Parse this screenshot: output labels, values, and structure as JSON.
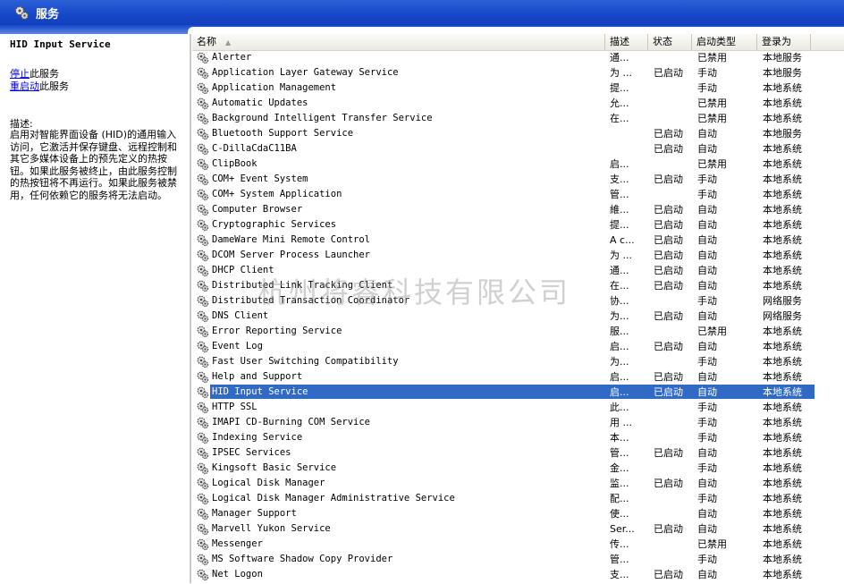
{
  "window": {
    "title": "服务"
  },
  "left_pane": {
    "service_title": "HID Input Service",
    "stop_link": "停止",
    "stop_suffix": "此服务",
    "restart_link": "重启动",
    "restart_suffix": "此服务",
    "desc_heading": "描述:",
    "desc_text": "启用对智能界面设备 (HID)的通用输入访问，它激活并保存键盘、远程控制和其它多媒体设备上的预先定义的热按钮。如果此服务被终止，由此服务控制的热按钮将不再运行。如果此服务被禁用，任何依赖它的服务将无法启动。"
  },
  "list": {
    "headers": {
      "name": "名称",
      "desc": "描述",
      "status": "状态",
      "startup": "启动类型",
      "logon": "登录为"
    },
    "selected_index": 22,
    "rows": [
      {
        "name": "Alerter",
        "desc": "通...",
        "status": "",
        "startup": "已禁用",
        "logon": "本地服务"
      },
      {
        "name": "Application Layer Gateway Service",
        "desc": "为 ...",
        "status": "已启动",
        "startup": "手动",
        "logon": "本地服务"
      },
      {
        "name": "Application Management",
        "desc": "提...",
        "status": "",
        "startup": "手动",
        "logon": "本地系统"
      },
      {
        "name": "Automatic Updates",
        "desc": "允...",
        "status": "",
        "startup": "已禁用",
        "logon": "本地系统"
      },
      {
        "name": "Background Intelligent Transfer Service",
        "desc": "在...",
        "status": "",
        "startup": "已禁用",
        "logon": "本地系统"
      },
      {
        "name": "Bluetooth Support Service",
        "desc": "",
        "status": "已启动",
        "startup": "自动",
        "logon": "本地服务"
      },
      {
        "name": "C-DillaCdaC11BA",
        "desc": "",
        "status": "已启动",
        "startup": "自动",
        "logon": "本地系统"
      },
      {
        "name": "ClipBook",
        "desc": "启...",
        "status": "",
        "startup": "已禁用",
        "logon": "本地系统"
      },
      {
        "name": "COM+ Event System",
        "desc": "支...",
        "status": "已启动",
        "startup": "手动",
        "logon": "本地系统"
      },
      {
        "name": "COM+ System Application",
        "desc": "管...",
        "status": "",
        "startup": "手动",
        "logon": "本地系统"
      },
      {
        "name": "Computer Browser",
        "desc": "維...",
        "status": "已启动",
        "startup": "自动",
        "logon": "本地系统"
      },
      {
        "name": "Cryptographic Services",
        "desc": "提...",
        "status": "已启动",
        "startup": "自动",
        "logon": "本地系统"
      },
      {
        "name": "DameWare Mini Remote Control",
        "desc": "A c...",
        "status": "已启动",
        "startup": "自动",
        "logon": "本地系统"
      },
      {
        "name": "DCOM Server Process Launcher",
        "desc": "为 ...",
        "status": "已启动",
        "startup": "自动",
        "logon": "本地系统"
      },
      {
        "name": "DHCP Client",
        "desc": "通...",
        "status": "已启动",
        "startup": "自动",
        "logon": "本地系统"
      },
      {
        "name": "Distributed Link Tracking Client",
        "desc": "在...",
        "status": "已启动",
        "startup": "自动",
        "logon": "本地系统"
      },
      {
        "name": "Distributed Transaction Coordinator",
        "desc": "协...",
        "status": "",
        "startup": "手动",
        "logon": "网络服务"
      },
      {
        "name": "DNS Client",
        "desc": "为...",
        "status": "已启动",
        "startup": "自动",
        "logon": "网络服务"
      },
      {
        "name": "Error Reporting Service",
        "desc": "服...",
        "status": "",
        "startup": "已禁用",
        "logon": "本地系统"
      },
      {
        "name": "Event Log",
        "desc": "启...",
        "status": "已启动",
        "startup": "自动",
        "logon": "本地系统"
      },
      {
        "name": "Fast User Switching Compatibility",
        "desc": "为...",
        "status": "",
        "startup": "手动",
        "logon": "本地系统"
      },
      {
        "name": "Help and Support",
        "desc": "启...",
        "status": "已启动",
        "startup": "自动",
        "logon": "本地系统"
      },
      {
        "name": "HID Input Service",
        "desc": "启...",
        "status": "已启动",
        "startup": "自动",
        "logon": "本地系统"
      },
      {
        "name": "HTTP SSL",
        "desc": "此...",
        "status": "",
        "startup": "手动",
        "logon": "本地系统"
      },
      {
        "name": "IMAPI CD-Burning COM Service",
        "desc": "用 ...",
        "status": "",
        "startup": "手动",
        "logon": "本地系统"
      },
      {
        "name": "Indexing Service",
        "desc": "本...",
        "status": "",
        "startup": "手动",
        "logon": "本地系统"
      },
      {
        "name": "IPSEC Services",
        "desc": "管...",
        "status": "已启动",
        "startup": "自动",
        "logon": "本地系统"
      },
      {
        "name": "Kingsoft Basic Service",
        "desc": "金...",
        "status": "",
        "startup": "手动",
        "logon": "本地系统"
      },
      {
        "name": "Logical Disk Manager",
        "desc": "监...",
        "status": "已启动",
        "startup": "自动",
        "logon": "本地系统"
      },
      {
        "name": "Logical Disk Manager Administrative Service",
        "desc": "配...",
        "status": "",
        "startup": "手动",
        "logon": "本地系统"
      },
      {
        "name": "Manager Support",
        "desc": "使...",
        "status": "",
        "startup": "自动",
        "logon": "本地系统"
      },
      {
        "name": "Marvell Yukon Service",
        "desc": "Ser...",
        "status": "已启动",
        "startup": "自动",
        "logon": "本地系统"
      },
      {
        "name": "Messenger",
        "desc": "传...",
        "status": "",
        "startup": "已禁用",
        "logon": "本地系统"
      },
      {
        "name": "MS Software Shadow Copy Provider",
        "desc": "管...",
        "status": "",
        "startup": "手动",
        "logon": "本地系统"
      },
      {
        "name": "Net Logon",
        "desc": "支...",
        "status": "已启动",
        "startup": "自动",
        "logon": "本地系统"
      }
    ]
  },
  "watermark": "杭州将睿科技有限公司"
}
